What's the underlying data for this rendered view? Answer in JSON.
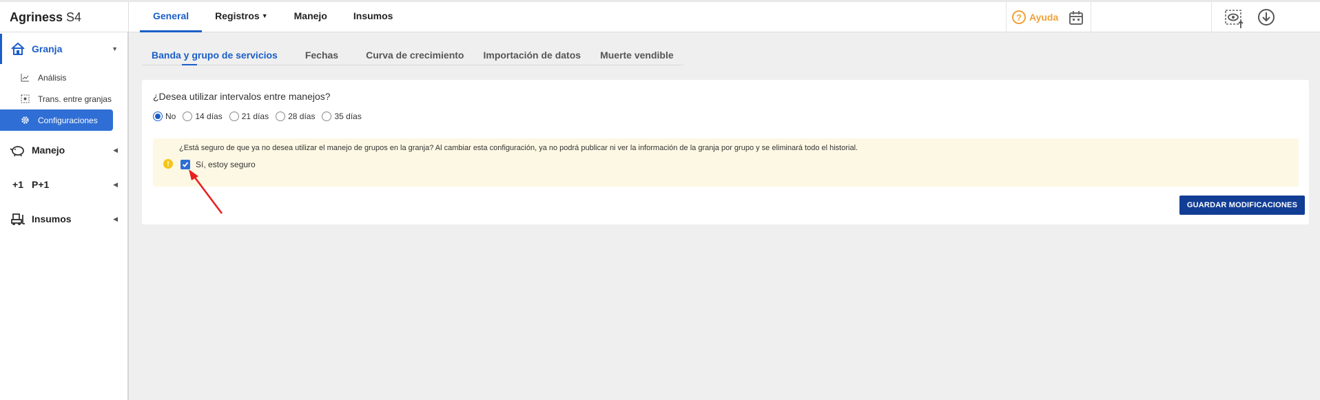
{
  "app": {
    "name_bold": "Agriness",
    "name_rest": " S4"
  },
  "topnav": [
    {
      "label": "General",
      "active": true
    },
    {
      "label": "Registros",
      "dropdown": true
    },
    {
      "label": "Manejo"
    },
    {
      "label": "Insumos"
    }
  ],
  "header": {
    "help_label": "Ayuda"
  },
  "sidebar": {
    "groups": [
      {
        "label": "Granja",
        "icon": "home-icon",
        "active": true,
        "items": [
          {
            "label": "Análisis",
            "icon": "chart-line-icon"
          },
          {
            "label": "Trans. entre granjas",
            "icon": "transfer-icon"
          },
          {
            "label": "Configuraciones",
            "icon": "gear-icon",
            "active": true
          }
        ]
      },
      {
        "label": "Manejo",
        "icon": "piggy-icon"
      },
      {
        "label": "P+1",
        "icon": "plus-one-icon"
      },
      {
        "label": "Insumos",
        "icon": "forklift-icon"
      }
    ]
  },
  "tabs": [
    {
      "label": "Banda y grupo de servicios",
      "active": true
    },
    {
      "label": "Fechas"
    },
    {
      "label": "Curva de crecimiento"
    },
    {
      "label": "Importación de datos"
    },
    {
      "label": "Muerte vendible"
    }
  ],
  "form": {
    "question": "¿Desea utilizar intervalos entre manejos?",
    "options": [
      "No",
      "14 días",
      "21 días",
      "28 días",
      "35 días"
    ],
    "selected": "No",
    "warning": "¿Está seguro de que ya no desea utilizar el manejo de grupos en la granja? Al cambiar esta configuración, ya no podrá publicar ni ver la información de la granja por grupo y se eliminará todo el historial.",
    "confirm_label": "Sí, estoy seguro",
    "confirm_checked": true,
    "save_label": "GUARDAR MODIFICACIONES"
  },
  "colors": {
    "primary": "#1a5ec8",
    "button": "#123d94",
    "warning_bg": "#fdf8e4",
    "help": "#f0a23a",
    "annotation": "#e8201f"
  }
}
